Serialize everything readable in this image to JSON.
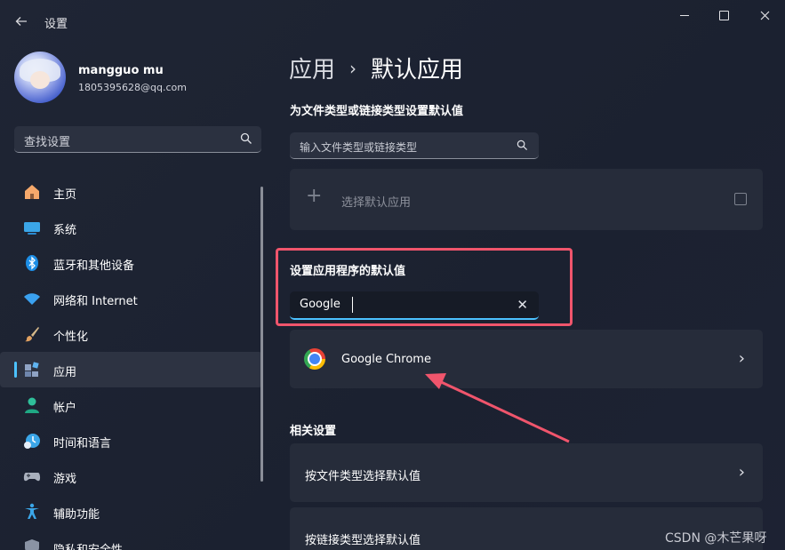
{
  "window": {
    "title": "设置",
    "controls": {
      "minimize": "minimize",
      "maximize": "maximize",
      "close": "close"
    }
  },
  "user": {
    "name": "mangguo mu",
    "email": "1805395628@qq.com"
  },
  "sidebar": {
    "search_placeholder": "查找设置",
    "items": [
      {
        "label": "主页",
        "icon": "home-icon",
        "active": false
      },
      {
        "label": "系统",
        "icon": "system-display-icon",
        "active": false
      },
      {
        "label": "蓝牙和其他设备",
        "icon": "bluetooth-icon",
        "active": false
      },
      {
        "label": "网络和 Internet",
        "icon": "wifi-icon",
        "active": false
      },
      {
        "label": "个性化",
        "icon": "paintbrush-icon",
        "active": false
      },
      {
        "label": "应用",
        "icon": "apps-icon",
        "active": true
      },
      {
        "label": "帐户",
        "icon": "account-icon",
        "active": false
      },
      {
        "label": "时间和语言",
        "icon": "time-language-icon",
        "active": false
      },
      {
        "label": "游戏",
        "icon": "gamepad-icon",
        "active": false
      },
      {
        "label": "辅助功能",
        "icon": "accessibility-icon",
        "active": false
      },
      {
        "label": "隐私和安全性",
        "icon": "shield-icon",
        "active": false
      }
    ]
  },
  "main": {
    "breadcrumb": {
      "parent": "应用",
      "separator": "›",
      "current": "默认应用"
    },
    "file_type_section": {
      "title": "为文件类型或链接类型设置默认值",
      "placeholder": "输入文件类型或链接类型",
      "choose_default": "选择默认应用"
    },
    "app_section": {
      "title": "设置应用程序的默认值",
      "search_value": "Google",
      "result": "Google Chrome"
    },
    "related": {
      "title": "相关设置",
      "items": [
        {
          "label": "按文件类型选择默认值"
        },
        {
          "label": "按链接类型选择默认值"
        }
      ]
    }
  },
  "watermark": "CSDN @木芒果呀",
  "colors": {
    "accent": "#4cc2ff",
    "highlight": "#f0556c"
  }
}
